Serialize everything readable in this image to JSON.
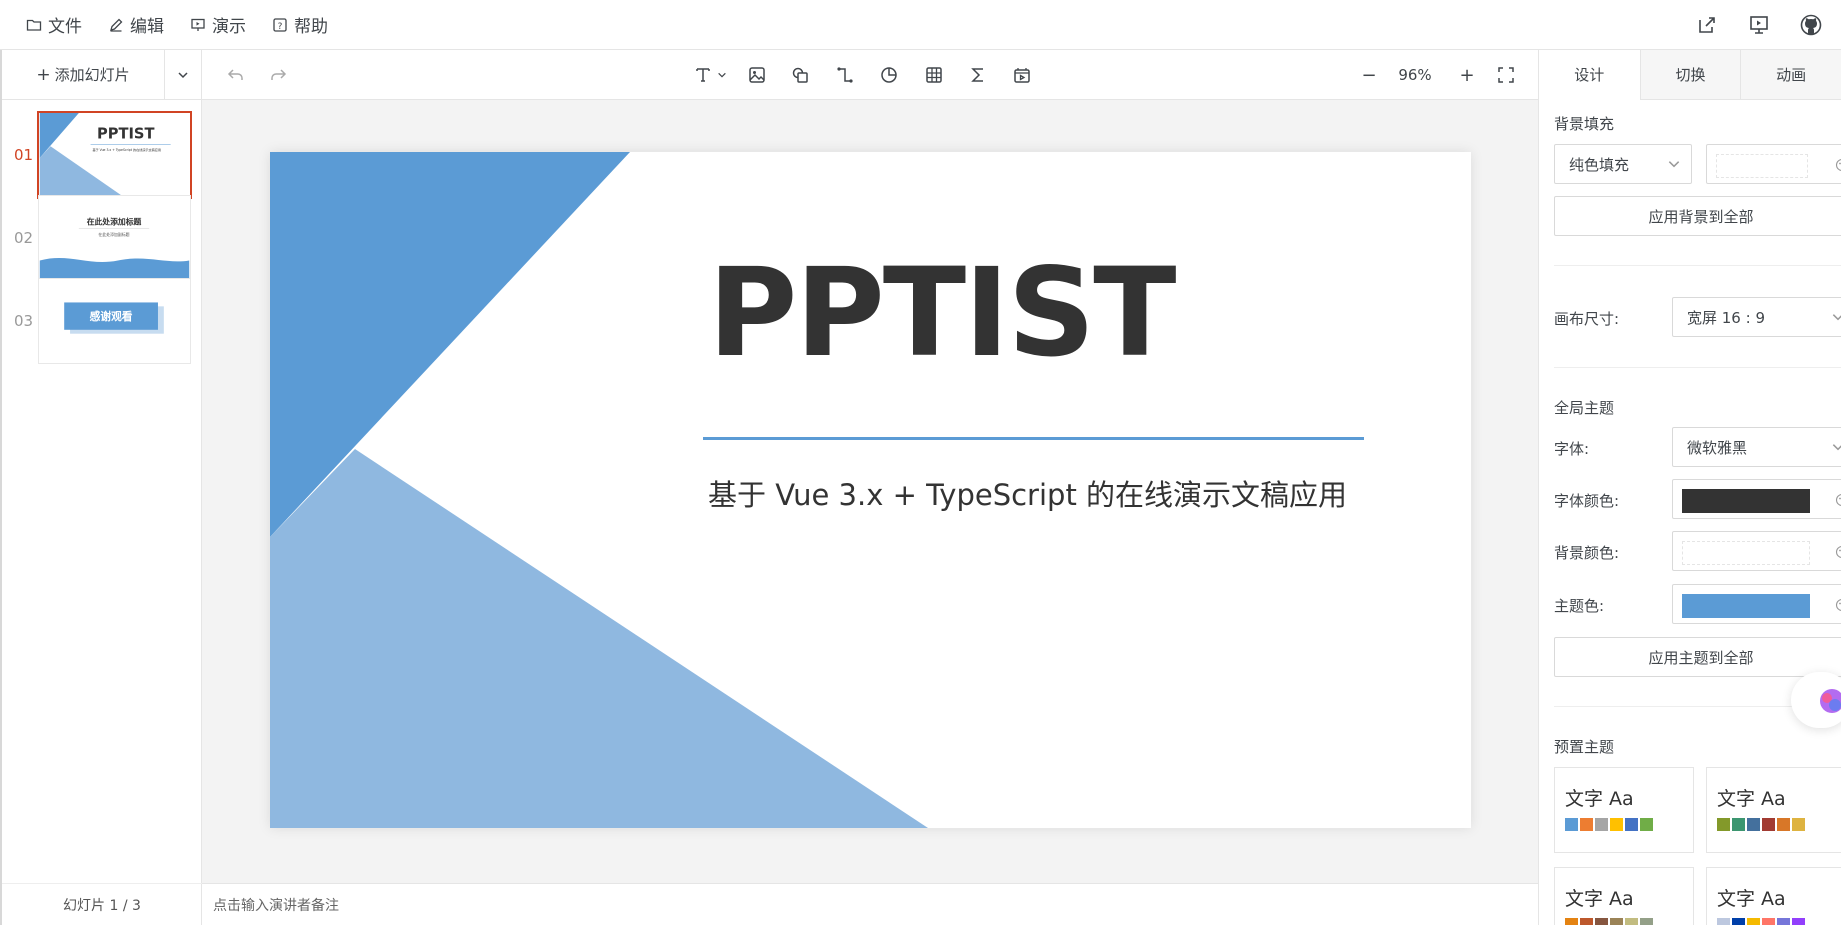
{
  "menu": {
    "file": "文件",
    "edit": "编辑",
    "present": "演示",
    "help": "帮助"
  },
  "left": {
    "add_slide": "添加幻灯片",
    "thumbs": [
      {
        "num": "01",
        "title": "PPTIST",
        "subtitle": "基于 Vue 3.x + TypeScript 的在线演示文稿应用"
      },
      {
        "num": "02",
        "title": "在此处添加标题",
        "subtitle": "在此处添加副标题"
      },
      {
        "num": "03",
        "title": "感谢观看"
      }
    ],
    "counter": "幻灯片 1 / 3"
  },
  "toolbar": {
    "zoom_minus": "−",
    "zoom": "96%",
    "zoom_plus": "+"
  },
  "slide": {
    "title": "PPTIST",
    "subtitle": "基于 Vue 3.x + TypeScript 的在线演示文稿应用",
    "theme_color": "#5b9bd5",
    "light_color": "#8fb8e0"
  },
  "notes": {
    "placeholder": "点击输入演讲者备注"
  },
  "right": {
    "tabs": [
      "设计",
      "切换",
      "动画"
    ],
    "bg_fill_label": "背景填充",
    "bg_fill_value": "纯色填充",
    "apply_bg_all": "应用背景到全部",
    "canvas_size_label": "画布尺寸:",
    "canvas_size_value": "宽屏 16 : 9",
    "global_theme_label": "全局主题",
    "font_label": "字体:",
    "font_value": "微软雅黑",
    "font_color_label": "字体颜色:",
    "font_color": "#333333",
    "bg_color_label": "背景颜色:",
    "bg_color": "#ffffff",
    "theme_color_label": "主题色:",
    "theme_color": "#5b9bd5",
    "apply_theme_all": "应用主题到全部",
    "preset_label": "预置主题",
    "presets": [
      {
        "text": "文字 Aa",
        "colors": [
          "#5b9bd5",
          "#ed7d31",
          "#a5a5a5",
          "#ffc000",
          "#4472c4",
          "#70ad47"
        ]
      },
      {
        "text": "文字 Aa",
        "colors": [
          "#83992a",
          "#3c9670",
          "#44709d",
          "#a23b32",
          "#d87728",
          "#deb340"
        ]
      },
      {
        "text": "文字 Aa",
        "colors": [
          "#e48312",
          "#bd582c",
          "#865640",
          "#9b8357",
          "#c2bc80",
          "#94a088"
        ]
      },
      {
        "text": "文字 Aa",
        "colors": [
          "#bdc8df",
          "#003fa9",
          "#f5ba00",
          "#ff7567",
          "#7676d9",
          "#923ffc"
        ]
      }
    ]
  }
}
